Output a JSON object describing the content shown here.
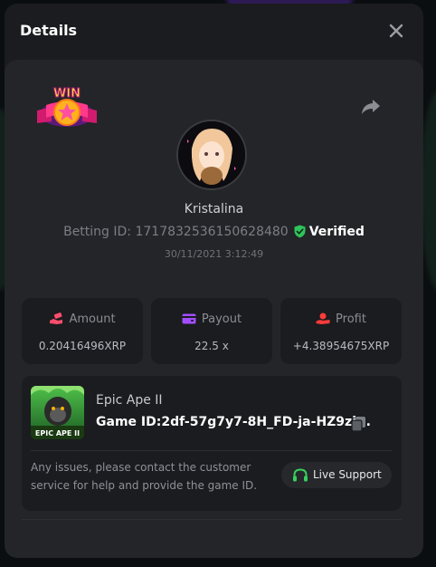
{
  "modal": {
    "title": "Details"
  },
  "bet": {
    "username": "Kristalina",
    "betting_id_label": "Betting ID:",
    "betting_id": "1717832536150628480",
    "verified_label": "Verified",
    "timestamp": "30/11/2021 3:12:49",
    "badge_text": "WIN"
  },
  "stats": [
    {
      "label": "Amount",
      "value": "0.20416496XRP",
      "icon": "money-hand-icon",
      "color": "#ff4d6d"
    },
    {
      "label": "Payout",
      "value": "22.5 x",
      "icon": "wallet-icon",
      "color": "#a24dff"
    },
    {
      "label": "Profit",
      "value": "+4.38954675XRP",
      "icon": "coin-hand-icon",
      "color": "#ff3b3b"
    }
  ],
  "game": {
    "name": "Epic Ape II",
    "id_label": "Game ID:",
    "id_value": "2df-57g7y7-8H_FD-ja-HZ9zj...",
    "thumb_text": "EPIC APE II"
  },
  "notice": "Any issues, please contact the customer service for help and provide the game ID.",
  "support": {
    "label": "Live Support",
    "color": "#37d05c"
  },
  "colors": {
    "verified_green": "#2fc35b",
    "modal_bg": "#1a1c1f",
    "content_bg": "#232528"
  }
}
